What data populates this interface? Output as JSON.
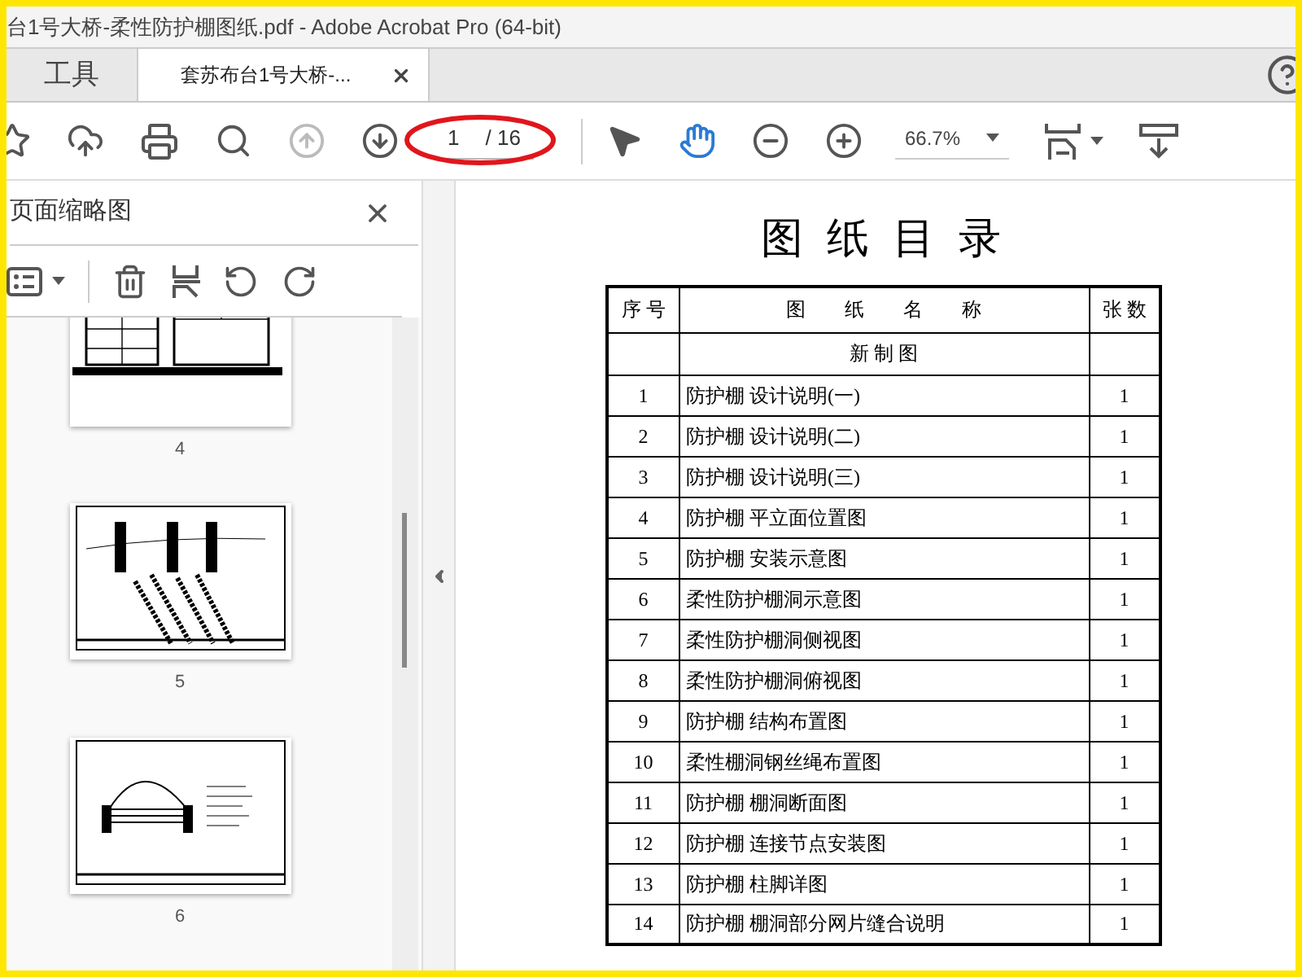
{
  "window": {
    "title": "台1号大桥-柔性防护棚图纸.pdf - Adobe Acrobat Pro (64-bit)"
  },
  "tabs": [
    {
      "label": "工具",
      "selected": false,
      "closable": false
    },
    {
      "label": "套苏布台1号大桥-...",
      "selected": true,
      "closable": true
    }
  ],
  "toolbar": {
    "buttons": [
      {
        "kind": "bookmark",
        "disabled": false
      },
      {
        "kind": "upload",
        "disabled": false
      },
      {
        "kind": "print",
        "disabled": false
      },
      {
        "kind": "find",
        "disabled": false
      },
      {
        "kind": "prev",
        "disabled": true
      },
      {
        "kind": "next",
        "disabled": false
      }
    ],
    "page_field": {
      "value": "1",
      "total": "/ 16",
      "highlighted": true
    },
    "tools": [
      {
        "kind": "select",
        "selected": false
      },
      {
        "kind": "hand",
        "selected": true
      },
      {
        "kind": "zoom-out",
        "selected": false
      },
      {
        "kind": "zoom-in",
        "selected": false
      }
    ],
    "zoom": "66.7%"
  },
  "sidebar": {
    "title": "页面缩略图",
    "thumbnails": [
      {
        "label": "4",
        "kind": "table"
      },
      {
        "label": "5",
        "kind": "plan"
      },
      {
        "label": "6",
        "kind": "arch"
      }
    ]
  },
  "document": {
    "heading": "图 纸 目 录",
    "columns": [
      "序 号",
      "图　　纸　　名　　称",
      "张 数"
    ],
    "section": "新 制 图",
    "rows": [
      {
        "no": "1",
        "name": "防护棚 设计说明(一)",
        "count": "1"
      },
      {
        "no": "2",
        "name": "防护棚 设计说明(二)",
        "count": "1"
      },
      {
        "no": "3",
        "name": "防护棚 设计说明(三)",
        "count": "1"
      },
      {
        "no": "4",
        "name": "防护棚 平立面位置图",
        "count": "1"
      },
      {
        "no": "5",
        "name": "防护棚 安装示意图",
        "count": "1"
      },
      {
        "no": "6",
        "name": "柔性防护棚洞示意图",
        "count": "1"
      },
      {
        "no": "7",
        "name": "柔性防护棚洞侧视图",
        "count": "1"
      },
      {
        "no": "8",
        "name": "柔性防护棚洞俯视图",
        "count": "1"
      },
      {
        "no": "9",
        "name": "防护棚 结构布置图",
        "count": "1"
      },
      {
        "no": "10",
        "name": "柔性棚洞钢丝绳布置图",
        "count": "1"
      },
      {
        "no": "11",
        "name": "防护棚 棚洞断面图",
        "count": "1"
      },
      {
        "no": "12",
        "name": "防护棚 连接节点安装图",
        "count": "1"
      },
      {
        "no": "13",
        "name": "防护棚 柱脚详图",
        "count": "1"
      },
      {
        "no": "14",
        "name": "防护棚 棚洞部分网片缝合说明",
        "count": "1"
      }
    ]
  }
}
